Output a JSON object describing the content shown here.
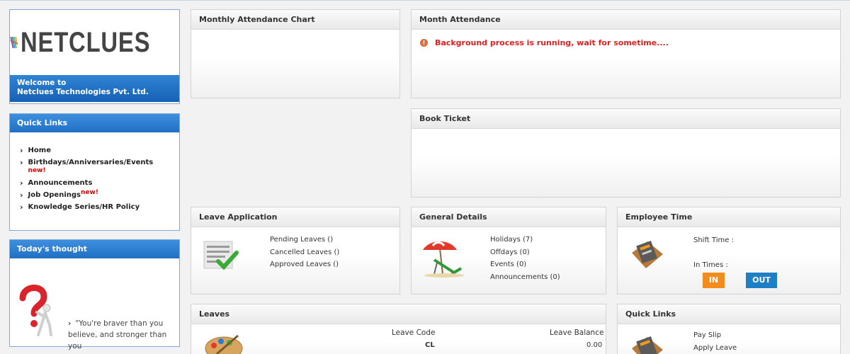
{
  "company": {
    "logo_text": "NETCLUES",
    "welcome_line1": "Welcome to",
    "welcome_line2": "Netclues Technologies Pvt. Ltd."
  },
  "quick_links_left": {
    "title": "Quick Links",
    "items": [
      {
        "label": "Home",
        "new": ""
      },
      {
        "label": "Birthdays/Anniversaries/Events",
        "new": "new!"
      },
      {
        "label": "Announcements",
        "new": ""
      },
      {
        "label": "Job Openings",
        "new": "new!"
      },
      {
        "label": "Knowledge Series/HR Policy",
        "new": ""
      }
    ]
  },
  "thought": {
    "title": "Today's thought",
    "line1": "\"You're braver than you",
    "line2": "believe, and stronger than you"
  },
  "monthly_chart": {
    "title": "Monthly Attendance Chart"
  },
  "month_attendance": {
    "title": "Month Attendance",
    "message": "Background process is running, wait for sometime...."
  },
  "book_ticket": {
    "title": "Book Ticket"
  },
  "leave_application": {
    "title": "Leave Application",
    "pending": "Pending Leaves ()",
    "cancelled": "Cancelled Leaves ()",
    "approved": "Approved Leaves ()"
  },
  "general_details": {
    "title": "General Details",
    "holidays": "Holidays (7)",
    "offdays": "Offdays (0)",
    "events": "Events (0)",
    "announcements": "Announcements (0)"
  },
  "employee_time": {
    "title": "Employee Time",
    "shift_time": "Shift Time :",
    "in_times": "In Times :",
    "in_label": "IN",
    "out_label": "OUT"
  },
  "leaves": {
    "title": "Leaves",
    "col_code": "Leave Code",
    "col_balance": "Leave Balance",
    "row_code": "CL",
    "row_balance": "0.00"
  },
  "quick_links_right": {
    "title": "Quick Links",
    "pay_slip": "Pay Slip",
    "apply_leave": "Apply Leave"
  },
  "colors": {
    "accent_blue": "#1f6fc4",
    "alert_red": "#e02020",
    "in_orange": "#f28c1e",
    "out_blue": "#1d7fc6"
  }
}
